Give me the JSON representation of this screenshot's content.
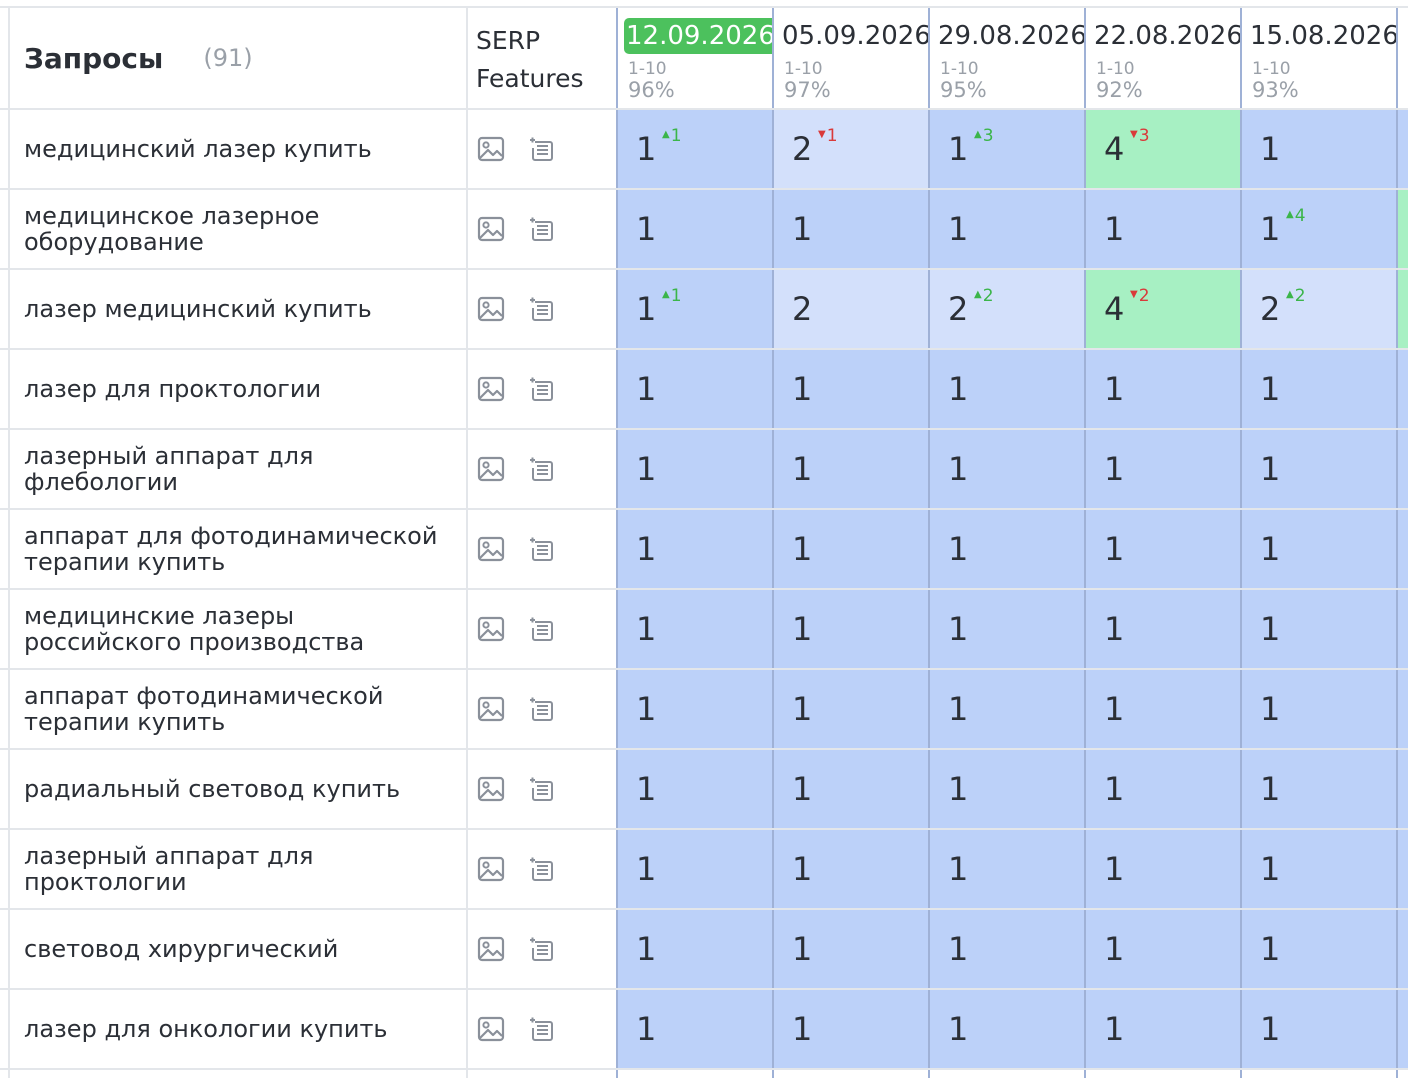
{
  "header": {
    "title": "Запросы",
    "count": "(91)",
    "serp_label_line1": "SERP",
    "serp_label_line2": "Features"
  },
  "dates": [
    {
      "label": "12.09.2026",
      "range": "1-10",
      "pct": "96%",
      "current": true
    },
    {
      "label": "05.09.2026",
      "range": "1-10",
      "pct": "97%",
      "current": false
    },
    {
      "label": "29.08.2026",
      "range": "1-10",
      "pct": "95%",
      "current": false
    },
    {
      "label": "22.08.2026",
      "range": "1-10",
      "pct": "92%",
      "current": false
    },
    {
      "label": "15.08.2026",
      "range": "1-10",
      "pct": "93%",
      "current": false
    }
  ],
  "colors": {
    "current_date_badge": "#4cc15d",
    "cell_top1": "#bcd1f9",
    "cell_top3": "#d3e0fb",
    "cell_top5": "#a7f0c3",
    "change_up": "#3bb54a",
    "change_down": "#d93a3a"
  },
  "icons": [
    "image-icon",
    "snippet-icon"
  ],
  "rows": [
    {
      "query": "медицинский лазер купить",
      "cells": [
        {
          "pos": "1",
          "chg": "1",
          "dir": "up"
        },
        {
          "pos": "2",
          "chg": "1",
          "dir": "down"
        },
        {
          "pos": "1",
          "chg": "3",
          "dir": "up"
        },
        {
          "pos": "4",
          "chg": "3",
          "dir": "down"
        },
        {
          "pos": "1",
          "chg": "",
          "dir": ""
        }
      ]
    },
    {
      "query": "медицинское лазерное оборудование",
      "cells": [
        {
          "pos": "1",
          "chg": "",
          "dir": ""
        },
        {
          "pos": "1",
          "chg": "",
          "dir": ""
        },
        {
          "pos": "1",
          "chg": "",
          "dir": ""
        },
        {
          "pos": "1",
          "chg": "",
          "dir": ""
        },
        {
          "pos": "1",
          "chg": "4",
          "dir": "up"
        }
      ]
    },
    {
      "query": "лазер медицинский купить",
      "cells": [
        {
          "pos": "1",
          "chg": "1",
          "dir": "up"
        },
        {
          "pos": "2",
          "chg": "",
          "dir": ""
        },
        {
          "pos": "2",
          "chg": "2",
          "dir": "up"
        },
        {
          "pos": "4",
          "chg": "2",
          "dir": "down"
        },
        {
          "pos": "2",
          "chg": "2",
          "dir": "up"
        }
      ]
    },
    {
      "query": "лазер для проктологии",
      "cells": [
        {
          "pos": "1",
          "chg": "",
          "dir": ""
        },
        {
          "pos": "1",
          "chg": "",
          "dir": ""
        },
        {
          "pos": "1",
          "chg": "",
          "dir": ""
        },
        {
          "pos": "1",
          "chg": "",
          "dir": ""
        },
        {
          "pos": "1",
          "chg": "",
          "dir": ""
        }
      ]
    },
    {
      "query": "лазерный аппарат для флебологии",
      "cells": [
        {
          "pos": "1",
          "chg": "",
          "dir": ""
        },
        {
          "pos": "1",
          "chg": "",
          "dir": ""
        },
        {
          "pos": "1",
          "chg": "",
          "dir": ""
        },
        {
          "pos": "1",
          "chg": "",
          "dir": ""
        },
        {
          "pos": "1",
          "chg": "",
          "dir": ""
        }
      ]
    },
    {
      "query": "аппарат для фотодинамической терапии купить",
      "cells": [
        {
          "pos": "1",
          "chg": "",
          "dir": ""
        },
        {
          "pos": "1",
          "chg": "",
          "dir": ""
        },
        {
          "pos": "1",
          "chg": "",
          "dir": ""
        },
        {
          "pos": "1",
          "chg": "",
          "dir": ""
        },
        {
          "pos": "1",
          "chg": "",
          "dir": ""
        }
      ]
    },
    {
      "query": "медицинские лазеры российского производства",
      "cells": [
        {
          "pos": "1",
          "chg": "",
          "dir": ""
        },
        {
          "pos": "1",
          "chg": "",
          "dir": ""
        },
        {
          "pos": "1",
          "chg": "",
          "dir": ""
        },
        {
          "pos": "1",
          "chg": "",
          "dir": ""
        },
        {
          "pos": "1",
          "chg": "",
          "dir": ""
        }
      ]
    },
    {
      "query": "аппарат фотодинамической терапии купить",
      "cells": [
        {
          "pos": "1",
          "chg": "",
          "dir": ""
        },
        {
          "pos": "1",
          "chg": "",
          "dir": ""
        },
        {
          "pos": "1",
          "chg": "",
          "dir": ""
        },
        {
          "pos": "1",
          "chg": "",
          "dir": ""
        },
        {
          "pos": "1",
          "chg": "",
          "dir": ""
        }
      ]
    },
    {
      "query": "радиальный световод купить",
      "cells": [
        {
          "pos": "1",
          "chg": "",
          "dir": ""
        },
        {
          "pos": "1",
          "chg": "",
          "dir": ""
        },
        {
          "pos": "1",
          "chg": "",
          "dir": ""
        },
        {
          "pos": "1",
          "chg": "",
          "dir": ""
        },
        {
          "pos": "1",
          "chg": "",
          "dir": ""
        }
      ]
    },
    {
      "query": "лазерный аппарат для проктологии",
      "cells": [
        {
          "pos": "1",
          "chg": "",
          "dir": ""
        },
        {
          "pos": "1",
          "chg": "",
          "dir": ""
        },
        {
          "pos": "1",
          "chg": "",
          "dir": ""
        },
        {
          "pos": "1",
          "chg": "",
          "dir": ""
        },
        {
          "pos": "1",
          "chg": "",
          "dir": ""
        }
      ]
    },
    {
      "query": "световод хирургический",
      "cells": [
        {
          "pos": "1",
          "chg": "",
          "dir": ""
        },
        {
          "pos": "1",
          "chg": "",
          "dir": ""
        },
        {
          "pos": "1",
          "chg": "",
          "dir": ""
        },
        {
          "pos": "1",
          "chg": "",
          "dir": ""
        },
        {
          "pos": "1",
          "chg": "",
          "dir": ""
        }
      ]
    },
    {
      "query": "лазер для онкологии купить",
      "cells": [
        {
          "pos": "1",
          "chg": "",
          "dir": ""
        },
        {
          "pos": "1",
          "chg": "",
          "dir": ""
        },
        {
          "pos": "1",
          "chg": "",
          "dir": ""
        },
        {
          "pos": "1",
          "chg": "",
          "dir": ""
        },
        {
          "pos": "1",
          "chg": "",
          "dir": ""
        }
      ]
    }
  ]
}
